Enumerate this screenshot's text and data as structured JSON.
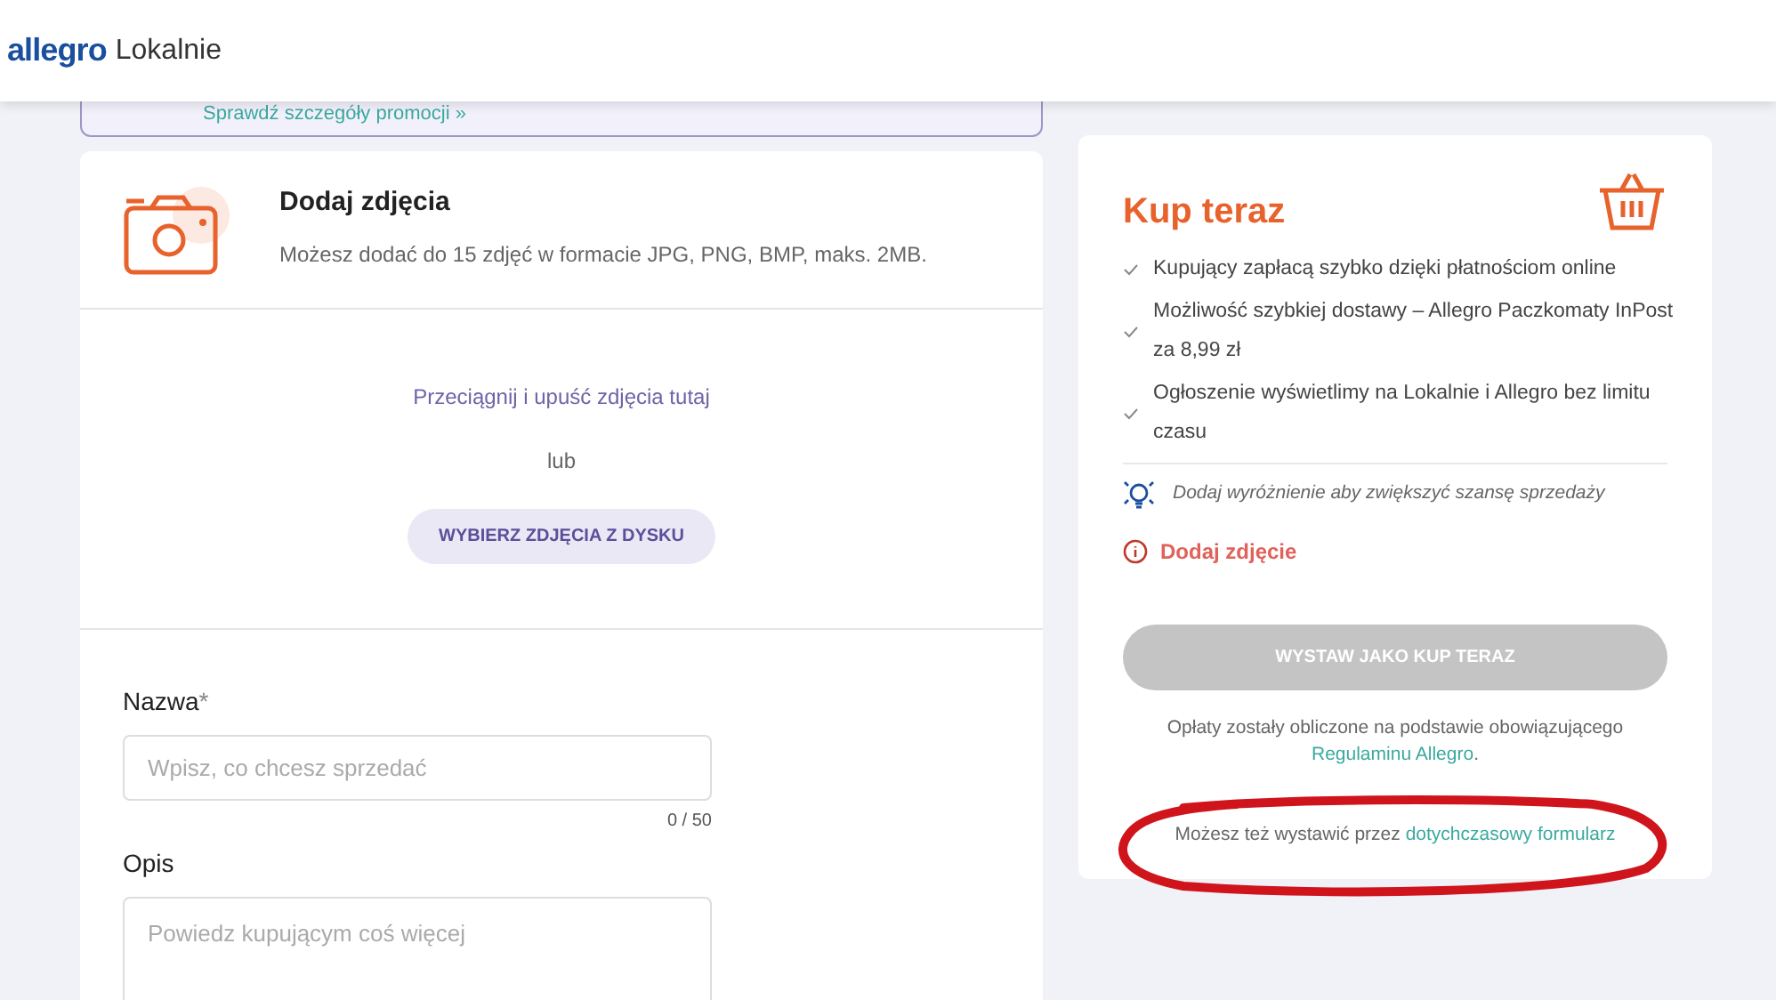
{
  "header": {
    "logo": "allegro",
    "product": "Lokalnie"
  },
  "promo": {
    "link": "Sprawdź szczegóły promocji »"
  },
  "photos": {
    "title": "Dodaj zdjęcia",
    "subtitle": "Możesz dodać do 15 zdjęć w formacie JPG, PNG, BMP, maks. 2MB.",
    "drop_hint": "Przeciągnij i upuść zdjęcia tutaj",
    "or": "lub",
    "button": "WYBIERZ ZDJĘCIA Z DYSKU"
  },
  "fields": [
    {
      "label": "Nazwa",
      "required_mark": "*",
      "placeholder": "Wpisz, co chcesz sprzedać",
      "counter": "0 / 50",
      "kind": "input"
    },
    {
      "label": "Opis",
      "placeholder": "Powiedz kupującym coś więcej",
      "kind": "textarea"
    }
  ],
  "buy_now": {
    "title": "Kup teraz",
    "benefits": [
      {
        "lines": [
          "Kupujący zapłacą szybko dzięki płatnościom online"
        ]
      },
      {
        "lines": [
          "Możliwość szybkiej dostawy – Allegro Paczkomaty InPost",
          "za 8,99 zł"
        ]
      },
      {
        "lines": [
          "Ogłoszenie wyświetlimy na Lokalnie i Allegro bez limitu",
          "czasu"
        ]
      }
    ],
    "tip": "Dodaj wyróżnienie aby zwiększyć szansę sprzedaży",
    "error": "Dodaj zdjęcie",
    "button": {
      "label": "WYSTAW JAKO KUP TERAZ",
      "disabled": true
    },
    "fees_note": "Opłaty zostały obliczone na podstawie obowiązującego",
    "fees_link": "Regulaminu Allegro",
    "fees_end": ".",
    "legacy_note": "Możesz też wystawić przez",
    "legacy_link": "dotychczasowy formularz"
  }
}
